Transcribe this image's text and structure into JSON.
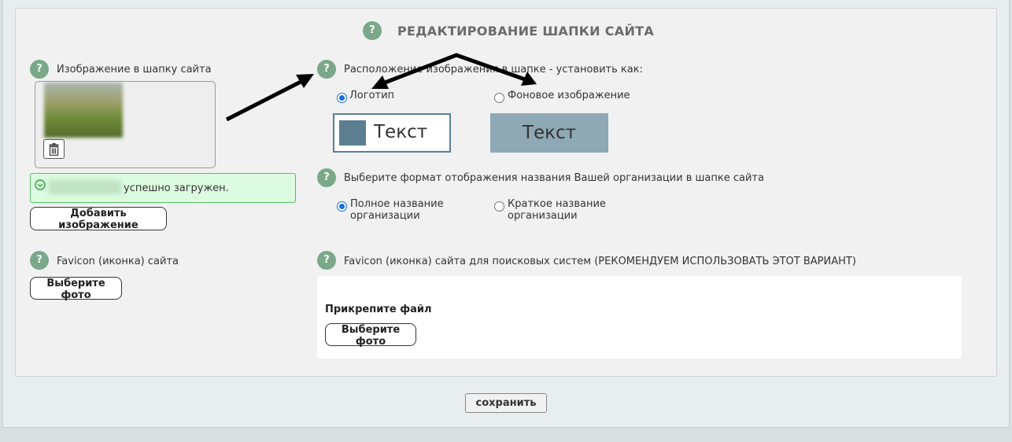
{
  "header": {
    "title": "РЕДАКТИРОВАНИЕ ШАПКИ САЙТА"
  },
  "help": {
    "glyph": "?"
  },
  "header_image": {
    "label": "Изображение в шапку сайта",
    "upload_status": "успешно загружен.",
    "add_button": "Добавить изображение"
  },
  "placement": {
    "label": "Расположение изображения в шапке - установить как:",
    "options": [
      {
        "label": "Логотип",
        "selected": true
      },
      {
        "label": "Фоновое изображение",
        "selected": false
      }
    ],
    "preview_text": "Текст"
  },
  "name_format": {
    "label": "Выберите формат отображения названия Вашей организации в шапке сайта",
    "options": [
      {
        "line1": "Полное название",
        "line2": "организации",
        "selected": true
      },
      {
        "line1": "Краткое название",
        "line2": "организации",
        "selected": false
      }
    ]
  },
  "favicon": {
    "label": "Favicon (иконка) сайта",
    "choose_button": "Выберите фото"
  },
  "favicon_search": {
    "label": "Favicon (иконка) сайта для поисковых систем (РЕКОМЕНДУЕМ ИСПОЛЬЗОВАТЬ ЭТОТ ВАРИАНТ)",
    "attach_label": "Прикрепите файл",
    "choose_button": "Выберите фото"
  },
  "footer": {
    "save_button": "сохранить"
  },
  "colors": {
    "help_green": "#7aa888",
    "preview_blue": "#5b7f91",
    "preview_bg": "#8ea8b4",
    "success_bg": "#dcfbe0",
    "success_border": "#5dbb6a",
    "radio_selected": "#1a6fd6"
  }
}
